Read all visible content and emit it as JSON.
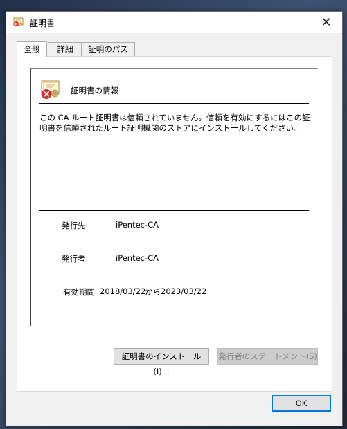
{
  "window": {
    "title": "証明書",
    "close_glyph": "✕"
  },
  "tabs": [
    {
      "label": "全般",
      "active": true
    },
    {
      "label": "詳細",
      "active": false
    },
    {
      "label": "証明のパス",
      "active": false
    }
  ],
  "info": {
    "title": "証明書の情報",
    "message": "この CA ルート証明書は信頼されていません。信頼を有効にするにはこの証明書を信頼されたルート証明機関のストアにインストールしてください。"
  },
  "fields": {
    "issued_to_label": "発行先:",
    "issued_to_value": "iPentec-CA",
    "issued_by_label": "発行者:",
    "issued_by_value": "iPentec-CA",
    "validity_label": "有効期間",
    "valid_from": "2018/03/22",
    "from_word": "から",
    "valid_to": "2023/03/22"
  },
  "buttons": {
    "install": "証明書のインストール(I)...",
    "issuer_statement": "発行者のステートメント(S)",
    "ok": "OK"
  },
  "icons": {
    "title": "certificate-icon",
    "info": "certificate-error-icon"
  },
  "colors": {
    "error_red": "#d52b2b",
    "accent_blue": "#0078d7",
    "seal_gold": "#e8b547"
  }
}
